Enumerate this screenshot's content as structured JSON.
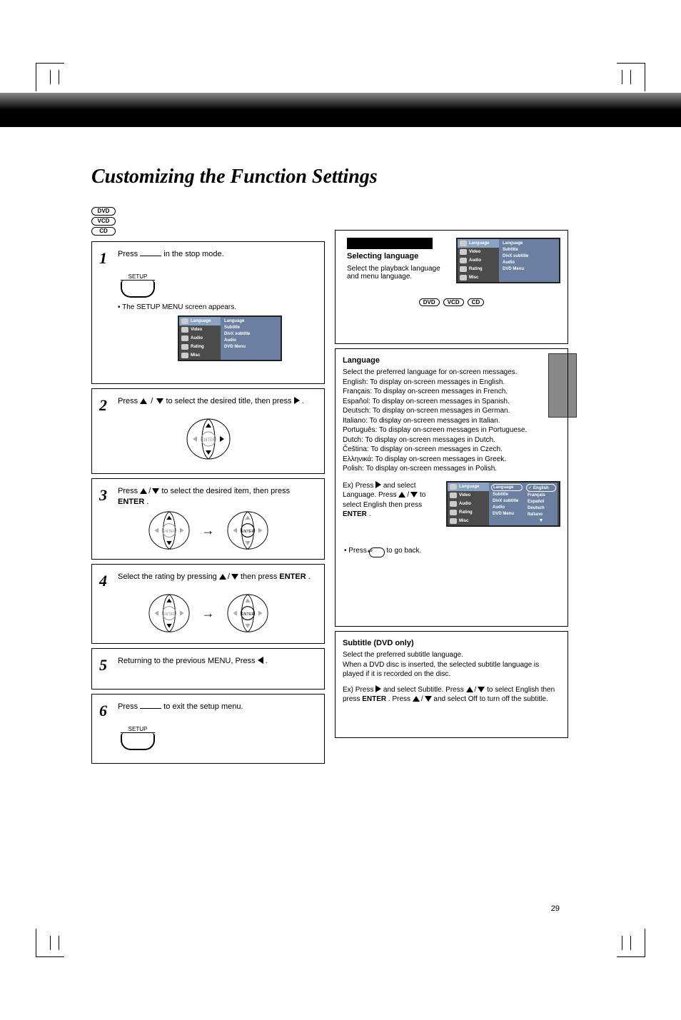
{
  "title": "Customizing the Function Settings",
  "discs": {
    "dvd": "DVD",
    "vcd": "VCD",
    "cd": "CD"
  },
  "left": {
    "s1": {
      "num": "1",
      "text_a": "Press ",
      "text_b": " in the stop mode.",
      "btn": "SETUP",
      "note": "• The SETUP MENU screen appears."
    },
    "s2": {
      "num": "2",
      "text_a": "Press ",
      "text_b": " to select the desired title, then press ",
      "text_c": "."
    },
    "s3": {
      "num": "3",
      "text_a": "Press ",
      "text_b": " to select the desired item, then press ",
      "bold": "ENTER",
      "text_c": "."
    },
    "s4": {
      "num": "4",
      "text_a": "Select the rating by pressing ",
      "text_b": " then press ",
      "bold": "ENTER",
      "text_c": "."
    },
    "s5": {
      "num": "5",
      "text": "Returning to the previous MENU, Press ",
      "text_b": "."
    },
    "s6": {
      "num": "6",
      "text_a": "Press ",
      "text_b": " to exit the setup menu.",
      "btn": "SETUP"
    }
  },
  "menu": {
    "side": {
      "language": "Language",
      "video": "Video",
      "audio": "Audio",
      "rating": "Rating",
      "misc": "Misc"
    },
    "main": {
      "language": "Language",
      "subtitle": "Subtitle",
      "divx": "DivX subtitle",
      "audio": "Audio",
      "dvdmenu": "DVD Menu"
    },
    "langs": {
      "en": "English",
      "fr": "Français",
      "es": "Español",
      "de": "Deutsch",
      "it": "Italiano"
    }
  },
  "right": {
    "lang_heading": "Selecting language",
    "lang_intro": "Select the playback language and menu language.",
    "discstrip": {
      "dvd": "DVD",
      "vcd": "VCD",
      "cd": "CD"
    },
    "lang_block_head": "Language",
    "lang_block_body": "Select the preferred language for on-screen messages.\nEnglish: To display on-screen messages in English.\nFrançais: To display on-screen messages in French.\nEspañol: To display on-screen messages in Spanish.\nDeutsch: To display on-screen messages in German.\nItaliano: To display on-screen messages in Italian.\nPortuguês: To display on-screen messages in Portuguese.\nDutch: To display on-screen messages in Dutch.\nČeština: To display on-screen messages in Czech.\nΕλληνικά: To display on-screen messages in Greek.\nPolish: To display on-screen messages in Polish.",
    "ex_a": "Ex) Press ",
    "ex_b": " and select Language. Press ",
    "ex_c": " to select English then press ",
    "ex_enter": "ENTER",
    "ex_d": ".",
    "back_a": "• Press ",
    "back_b": " to go back.",
    "sub_head": "Subtitle (DVD only)",
    "sub_body": "Select the preferred subtitle language.\nWhen a DVD disc is inserted, the selected subtitle language is played if it is recorded on the disc.",
    "sub_ex_a": "Ex) Press ",
    "sub_ex_b": " and select Subtitle. Press ",
    "sub_ex_c": " to select English then press ",
    "sub_ex_enter": "ENTER",
    "sub_ex_d": ". Press ",
    "sub_ex_e": " and select Off to turn off the subtitle."
  },
  "pagenum": "29"
}
